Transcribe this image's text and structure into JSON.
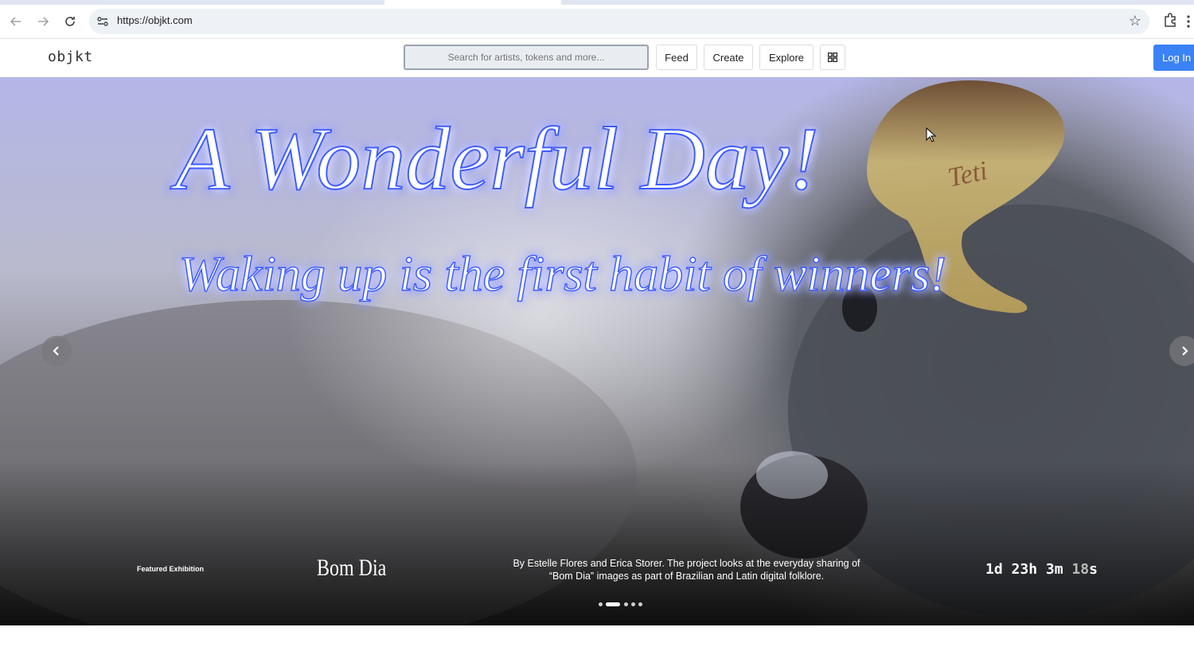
{
  "browser": {
    "url": "https://objkt.com",
    "icons": [
      "back-arrow-icon",
      "forward-arrow-icon",
      "reload-icon",
      "site-settings-icon",
      "bookmark-star-icon",
      "extensions-icon",
      "menu-icon"
    ]
  },
  "header": {
    "logo": "objkt",
    "search_placeholder": "Search for artists, tokens and more...",
    "nav": [
      "Feed",
      "Create",
      "Explore"
    ],
    "login": "Log In"
  },
  "hero": {
    "headline": "A Wonderful Day!",
    "subline": "Waking up is the first habit of winners!",
    "hat_text": "Teti",
    "featured_label": "Featured Exhibition",
    "exhibition_title": "Bom Dia",
    "description": "By Estelle Flores and Erica Storer. The project looks at the everyday sharing of “Bom Dia” images as part of Brazilian and Latin digital folklore.",
    "countdown": {
      "days": "1d",
      "hours": "23h",
      "minutes": "3m",
      "seconds_dim": "18",
      "seconds_unit": "s"
    },
    "slide_count": 5,
    "active_slide": 1
  },
  "colors": {
    "accent": "#3b82f6",
    "headline_glow": "#3d5bff"
  }
}
